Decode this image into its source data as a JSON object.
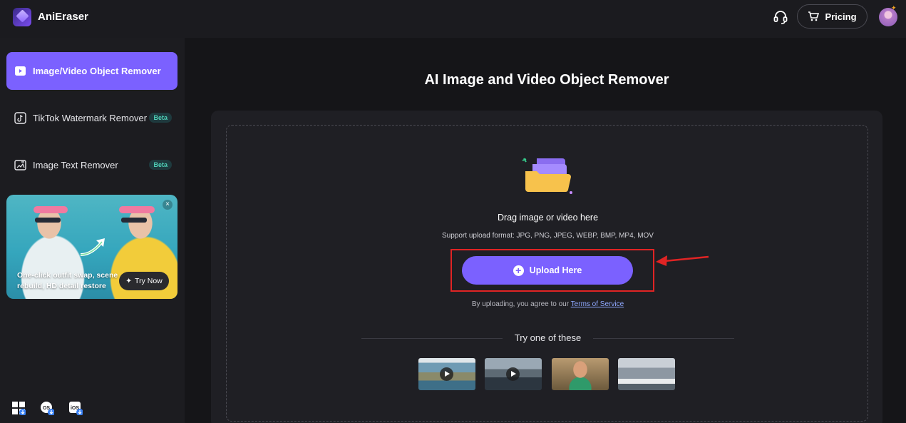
{
  "header": {
    "app_title": "AniEraser",
    "pricing_label": "Pricing",
    "icons": [
      "logo-icon",
      "headset-icon",
      "cart-icon",
      "avatar"
    ]
  },
  "sidebar": {
    "items": [
      {
        "label": "Image/Video Object Remover",
        "active": true,
        "icon": "play-box-icon"
      },
      {
        "label": "TikTok Watermark Remover",
        "badge": "Beta",
        "icon": "tiktok-icon"
      },
      {
        "label": "Image Text Remover",
        "badge": "Beta",
        "icon": "image-text-icon"
      }
    ],
    "promo": {
      "text": "One-click outfit swap, scene rebuild, HD detail restore",
      "button": "Try Now"
    },
    "os_downloads": [
      "windows-icon",
      "mac-os-icon",
      "ios-icon"
    ]
  },
  "main": {
    "title": "AI Image and Video Object Remover",
    "drag_text": "Drag image or video here",
    "format_text": "Support upload format: JPG, PNG, JPEG, WEBP, BMP, MP4, MOV",
    "upload_label": "Upload Here",
    "agree_prefix": "By uploading, you agree to our",
    "terms_link": "Terms of Service",
    "try_text": "Try one of these",
    "samples": [
      {
        "kind": "video",
        "name": "coastline-video"
      },
      {
        "kind": "video",
        "name": "volcano-video"
      },
      {
        "kind": "image",
        "name": "woman-image"
      },
      {
        "kind": "image",
        "name": "street-image"
      }
    ]
  },
  "colors": {
    "accent": "#7b61ff",
    "background": "#151518",
    "sidebar": "#1c1c20",
    "beta": "#4fd1b8",
    "annotation_red": "#e02424"
  }
}
